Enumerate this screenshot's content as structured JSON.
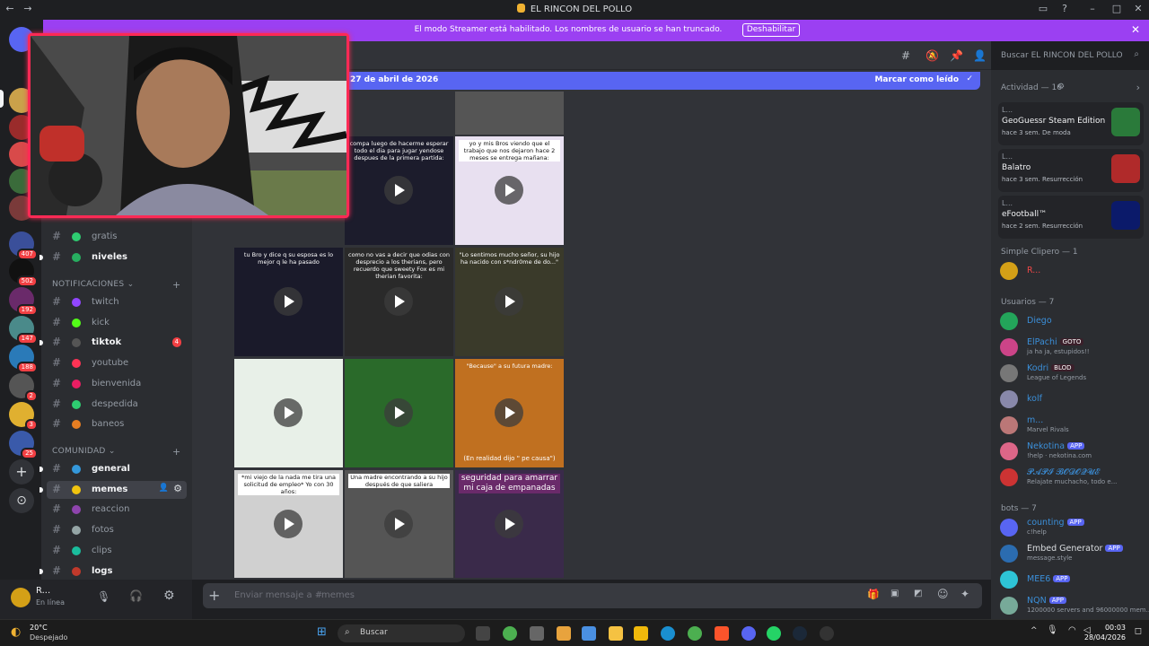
{
  "window": {
    "title": "EL RINCON DEL POLLO"
  },
  "streamer_banner": {
    "message": "El modo Streamer está habilitado. Los nombres de usuario se han truncado.",
    "button": "Deshabilitar"
  },
  "guild_badges": [
    "407",
    "502",
    "192",
    "147",
    "188",
    "2",
    "3",
    "25"
  ],
  "channels": {
    "top": [
      {
        "name": "gratis",
        "state": "normal"
      },
      {
        "name": "niveles",
        "state": "unread"
      }
    ],
    "categories": [
      {
        "name": "NOTIFICACIONES",
        "items": [
          {
            "name": "twitch",
            "color": "#9146ff",
            "state": "normal"
          },
          {
            "name": "kick",
            "color": "#53fc18",
            "state": "normal"
          },
          {
            "name": "tiktok",
            "color": "#555555",
            "state": "unread",
            "mention": "4"
          },
          {
            "name": "youtube",
            "color": "#ff3355",
            "state": "normal"
          },
          {
            "name": "bienvenida",
            "color": "#e91e63",
            "state": "normal"
          },
          {
            "name": "despedida",
            "color": "#2ecc71",
            "state": "normal"
          },
          {
            "name": "baneos",
            "color": "#e67e22",
            "state": "normal"
          }
        ]
      },
      {
        "name": "COMUNIDAD",
        "items": [
          {
            "name": "general",
            "color": "#3498db",
            "state": "unread"
          },
          {
            "name": "memes",
            "color": "#f1c40f",
            "state": "selected"
          },
          {
            "name": "reaccion",
            "color": "#8e44ad",
            "state": "normal"
          },
          {
            "name": "fotos",
            "color": "#95a5a6",
            "state": "normal"
          },
          {
            "name": "clips",
            "color": "#1abc9c",
            "state": "normal"
          },
          {
            "name": "logs",
            "color": "#c0392b",
            "state": "unread"
          }
        ]
      }
    ]
  },
  "user_panel": {
    "name": "R...",
    "status": "En línea"
  },
  "header": {
    "search_placeholder": "Buscar EL RINCON DEL POLLO"
  },
  "new_messages_bar": {
    "date": "27 de abril de 2026",
    "action": "Marcar como leído"
  },
  "media_captions": [
    "",
    "",
    "",
    "compa luego de hacerme esperar todo el dia para jugar yendose despues de la primera partida:",
    "yo y mis Bros viendo que el trabajo que nos dejaron hace 2 meses se entrega mañana:",
    "tu Bro y dice q su esposa es lo mejor q le ha pasado",
    "como no vas a decir que odias con desprecio a los therians, pero recuerdo que sweety Fox es mi therian favorita:",
    "\"Lo sentimos mucho señor, su hijo ha nacido con s*ndr0me de do...\"",
    "",
    "",
    "\"Because\" a su futura madre:",
    "*mi viejo de la nada me tira una solicitud de empleo* Yo con 30 años:",
    "Una madre encontrando a su hijo después de que saliera",
    "seguridad para amarrar mi caja de empanadas"
  ],
  "media_extra": {
    "overlay_text": "(En realidad dijo \" pe causa\")"
  },
  "composer": {
    "placeholder": "Enviar mensaje a #",
    "channel": "memes"
  },
  "members_panel": {
    "activity_header": "Actividad — 16",
    "activities": [
      {
        "user": "L...",
        "game": "GeoGuessr Steam Edition",
        "meta": "hace 3 sem.",
        "tag": "De moda",
        "color": "#2a7a3a"
      },
      {
        "user": "L...",
        "game": "Balatro",
        "meta": "hace 3 sem.",
        "tag": "Resurrección",
        "color": "#b02a2a"
      },
      {
        "user": "L...",
        "game": "eFootball™",
        "meta": "hace 2 sem.",
        "tag": "Resurrección",
        "color": "#0b1a6a"
      }
    ],
    "groups": [
      {
        "title": "Simple Clipero — 1",
        "members": [
          {
            "name": "R...",
            "color": "#f04747",
            "avatar": "#d4a017",
            "sub": ""
          }
        ]
      },
      {
        "title": "Usuarios — 7",
        "members": [
          {
            "name": "Diego",
            "color": "#3b8fd9",
            "avatar": "#23a55a",
            "sub": ""
          },
          {
            "name": "ElPachi",
            "color": "#3b8fd9",
            "avatar": "#c48",
            "tag": "GOTO",
            "sub": "ja ha ja, estupidos!!"
          },
          {
            "name": "Kodri",
            "color": "#3b8fd9",
            "avatar": "#777",
            "tag": "BLOD",
            "sub": "League of Legends"
          },
          {
            "name": "kolf",
            "color": "#3b8fd9",
            "avatar": "#88a",
            "sub": ""
          },
          {
            "name": "m...",
            "color": "#3b8fd9",
            "avatar": "#b77",
            "sub": "Marvel Rivals"
          },
          {
            "name": "Nekotina",
            "color": "#3b8fd9",
            "avatar": "#d68",
            "tag": "APP",
            "sub": "!help · nekotina.com"
          },
          {
            "name": "𝓟𝓐𝓟𝓘 𝓑𝓞𝓓𝓞𝓠𝓤𝓔",
            "color": "#3b8fd9",
            "avatar": "#c33",
            "sub": "Relajate muchacho, todo e..."
          }
        ]
      },
      {
        "title": "bots — 7",
        "members": [
          {
            "name": "counting",
            "color": "#3b8fd9",
            "avatar": "#5865f2",
            "tag": "APP",
            "sub": "c!help"
          },
          {
            "name": "Embed Generator",
            "color": "#dbdee1",
            "avatar": "#2b6cb0",
            "tag": "APP",
            "sub": "message.style"
          },
          {
            "name": "MEE6",
            "color": "#3b8fd9",
            "avatar": "#2ec4d6",
            "tag": "APP",
            "sub": ""
          },
          {
            "name": "NQN",
            "color": "#3b8fd9",
            "avatar": "#7a9",
            "tag": "APP",
            "sub": "1200000 servers and 96000000 mem..."
          }
        ]
      }
    ]
  },
  "taskbar": {
    "weather_temp": "20°C",
    "weather_desc": "Despejado",
    "search": "Buscar",
    "time": "00:03",
    "date": "28/04/2026"
  }
}
